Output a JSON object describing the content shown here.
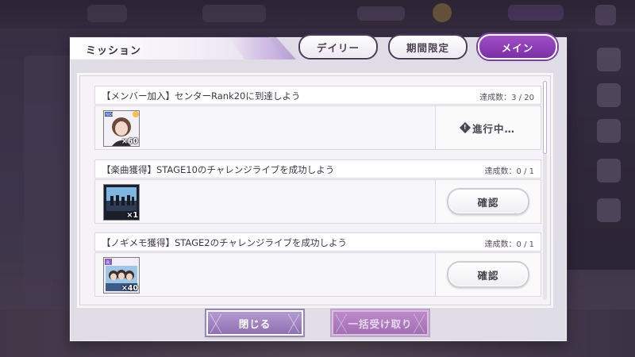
{
  "dialog": {
    "title": "ミッション"
  },
  "tabs": [
    {
      "label": "デイリー",
      "active": false
    },
    {
      "label": "期間限定",
      "active": false
    },
    {
      "label": "メイン",
      "active": true
    }
  ],
  "missions": [
    {
      "name": "【メンバー加入】センターRank20に到達しよう",
      "progress": "達成数：3 / 20",
      "reward_count": "×60",
      "reward_icon": "member-card-icon",
      "status": "in-progress",
      "status_label": "進行中…"
    },
    {
      "name": "【楽曲獲得】STAGE10のチャレンジライブを成功しよう",
      "progress": "達成数：0 / 1",
      "reward_count": "×1",
      "reward_icon": "song-jacket-icon",
      "status": "confirm",
      "button_label": "確認"
    },
    {
      "name": "【ノギメモ獲得】STAGE2のチャレンジライブを成功しよう",
      "progress": "達成数：0 / 1",
      "reward_count": "×40",
      "reward_icon": "nogimemo-card-icon",
      "status": "confirm",
      "button_label": "確認"
    }
  ],
  "footer": {
    "close_label": "閉じる",
    "claim_all_label": "一括受け取り"
  },
  "colors": {
    "accent": "#8a3cb5",
    "tab_border": "#4b3c5f"
  }
}
